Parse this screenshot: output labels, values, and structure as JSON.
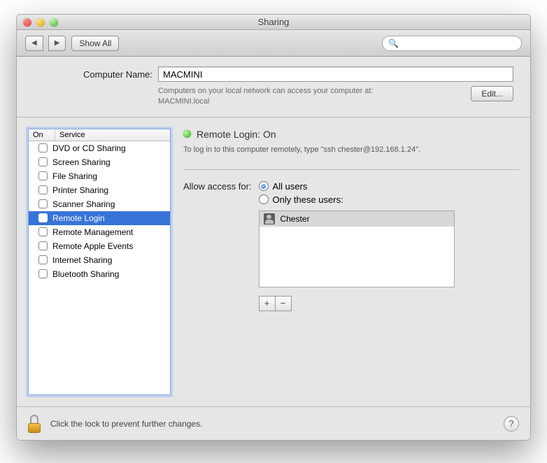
{
  "window": {
    "title": "Sharing"
  },
  "toolbar": {
    "back_glyph": "◀",
    "forward_glyph": "▶",
    "show_all": "Show All",
    "search_placeholder": ""
  },
  "computer_name": {
    "label": "Computer Name:",
    "value": "MACMINI",
    "hint_line1": "Computers on your local network can access your computer at:",
    "hint_line2": "MACMINI.local",
    "edit_button": "Edit..."
  },
  "services": {
    "head_on": "On",
    "head_service": "Service",
    "items": [
      {
        "label": "DVD or CD Sharing",
        "on": false
      },
      {
        "label": "Screen Sharing",
        "on": false
      },
      {
        "label": "File Sharing",
        "on": false
      },
      {
        "label": "Printer Sharing",
        "on": false
      },
      {
        "label": "Scanner Sharing",
        "on": false
      },
      {
        "label": "Remote Login",
        "on": true
      },
      {
        "label": "Remote Management",
        "on": false
      },
      {
        "label": "Remote Apple Events",
        "on": false
      },
      {
        "label": "Internet Sharing",
        "on": false
      },
      {
        "label": "Bluetooth Sharing",
        "on": false
      }
    ],
    "selected_index": 5
  },
  "detail": {
    "status_title": "Remote Login: On",
    "instruction": "To log in to this computer remotely, type \"ssh chester@192.168.1.24\".",
    "access_label": "Allow access for:",
    "radio_all": "All users",
    "radio_only": "Only these users:",
    "radio_selected": "all",
    "users": [
      {
        "name": "Chester"
      }
    ],
    "plus": "+",
    "minus": "−"
  },
  "footer": {
    "lock_text": "Click the lock to prevent further changes.",
    "help": "?"
  }
}
